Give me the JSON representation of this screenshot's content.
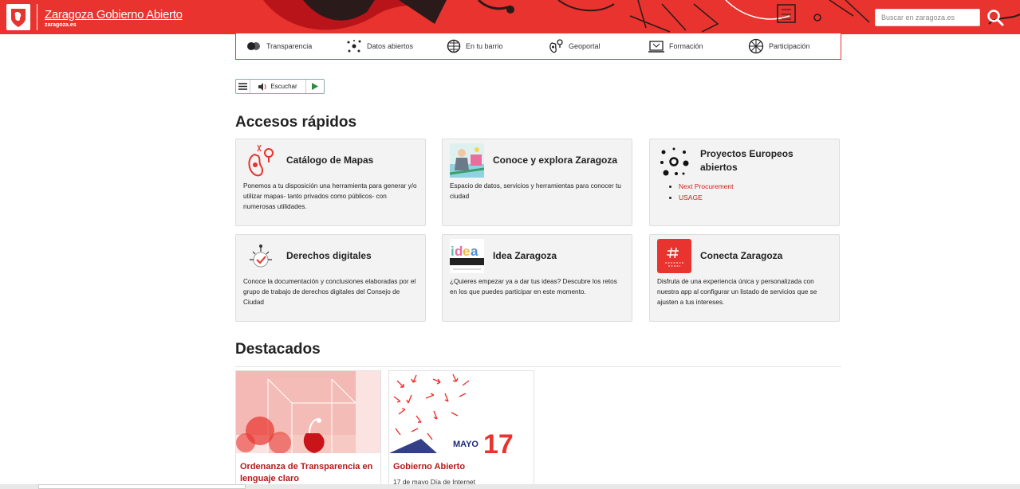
{
  "header": {
    "title": "Zaragoza Gobierno Abierto",
    "subtitle": "zaragoza.es",
    "search_placeholder": "Buscar en zaragoza.es"
  },
  "nav": {
    "items": [
      {
        "label": "Transparencia",
        "icon": "transparency-icon"
      },
      {
        "label": "Datos abiertos",
        "icon": "open-data-icon"
      },
      {
        "label": "En tu barrio",
        "icon": "neighborhood-icon"
      },
      {
        "label": "Geoportal",
        "icon": "geoportal-icon"
      },
      {
        "label": "Formación",
        "icon": "training-icon"
      },
      {
        "label": "Participación",
        "icon": "participation-icon"
      }
    ]
  },
  "listen": {
    "label": "Escuchar"
  },
  "quick_access": {
    "heading": "Accesos rápidos",
    "cards": [
      {
        "title": "Catálogo de Mapas",
        "icon": "map-pin-icon",
        "desc": "Ponemos a tu disposición una herramienta para generar y/o utilizar mapas- tanto privados como públicos- con numerosas utilidades."
      },
      {
        "title": "Conoce y explora Zaragoza",
        "icon": "explore-illustration-icon",
        "desc": "Espacio de datos, servicios y herramientas para conocer tu ciudad"
      },
      {
        "title": "Proyectos Europeos abiertos",
        "icon": "dots-network-icon",
        "links": [
          "Next Procurement",
          "USAGE"
        ]
      },
      {
        "title": "Derechos digitales",
        "icon": "digital-rights-icon",
        "desc": "Conoce la documentación y conclusiones elaboradas por el grupo de trabajo de derechos digitales del Consejo de Ciudad"
      },
      {
        "title": "Idea Zaragoza",
        "icon": "idea-zaragoza-logo-icon",
        "desc": "¿Quieres empezar ya a dar tus ideas? Descubre los retos en los que puedes participar en este momento."
      },
      {
        "title": "Conecta Zaragoza",
        "icon": "conecta-app-icon",
        "desc": "Disfruta de una experiencia única y personalizada con nuestra app al configurar un listado de servicios que se ajusten a tus intereses."
      }
    ]
  },
  "featured": {
    "heading": "Destacados",
    "items": [
      {
        "title": "Ordenanza de Transparencia en lenguaje claro",
        "date": ""
      },
      {
        "title": "Gobierno Abierto",
        "date": "17 de mayo Día de Internet",
        "badge_month": "MAYO",
        "badge_day": "17"
      }
    ]
  },
  "colors": {
    "brand": "#e8332e",
    "link": "#d21e1e"
  }
}
